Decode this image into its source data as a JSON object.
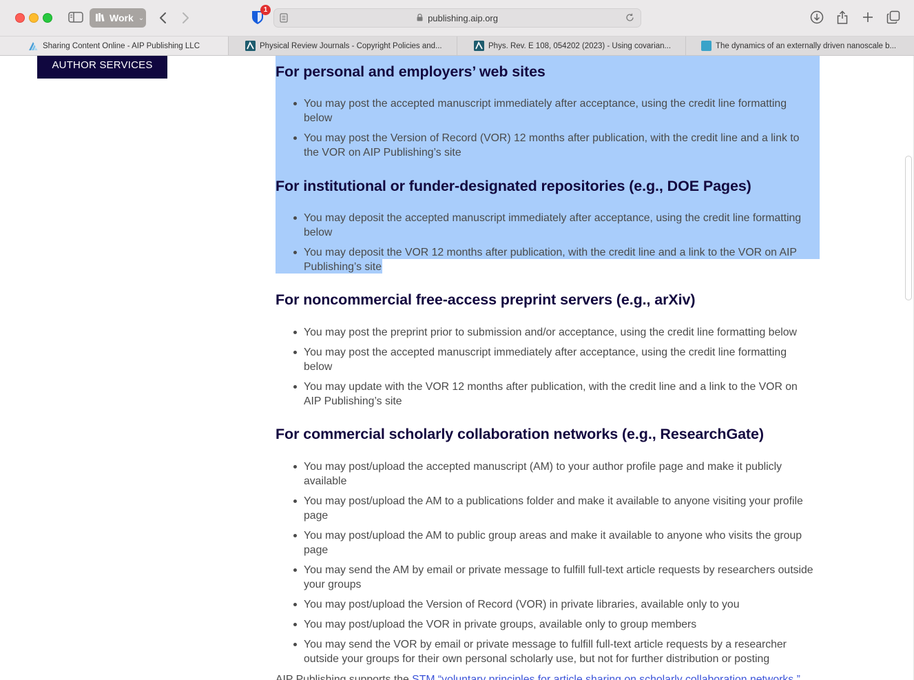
{
  "browser": {
    "profile": "Work",
    "extension_badge": "1",
    "address": "publishing.aip.org",
    "tabs": [
      {
        "title": "Sharing Content Online - AIP Publishing LLC",
        "active": true
      },
      {
        "title": "Physical Review Journals - Copyright Policies and...",
        "active": false
      },
      {
        "title": "Phys. Rev. E 108, 054202 (2023) - Using covarian...",
        "active": false
      },
      {
        "title": "The dynamics of an externally driven nanoscale b...",
        "active": false
      }
    ]
  },
  "sidebar": {
    "author_services": "AUTHOR SERVICES"
  },
  "sections": [
    {
      "heading": "For personal and employers’ web sites",
      "items": [
        "You may post the accepted manuscript immediately after acceptance, using the credit line formatting below",
        "You may post the Version of Record (VOR) 12 months after publication, with the credit line and a link to the VOR on AIP Publishing’s site"
      ]
    },
    {
      "heading": "For institutional or funder-designated repositories (e.g., DOE Pages)",
      "items": [
        "You may deposit the accepted manuscript immediately after acceptance, using the credit line formatting below",
        "You may deposit the VOR 12 months after publication, with the credit line and a link to the VOR on AIP Publishing’s site"
      ]
    },
    {
      "heading": "For noncommercial free-access preprint servers (e.g., arXiv)",
      "items": [
        "You may post the preprint prior to submission and/or acceptance, using the credit line formatting below",
        "You may post the accepted manuscript immediately after acceptance, using the credit line formatting below",
        "You may update with the VOR 12 months after publication, with the credit line and a link to the VOR on AIP Publishing’s site"
      ]
    },
    {
      "heading": "For commercial scholarly collaboration networks (e.g., ResearchGate)",
      "items": [
        "You may post/upload the accepted manuscript (AM) to your author profile page and make it publicly available",
        "You may post/upload the AM to a publications folder and make it available to anyone visiting your profile page",
        "You may post/upload the AM to public group areas and make it available to anyone who visits the group page",
        "You may send the AM by email or private message to fulfill full-text article requests by researchers outside your groups",
        "You may post/upload the Version of Record (VOR) in private libraries, available only to you",
        "You may post/upload the VOR in private groups, available only to group members",
        "You may send the VOR by email or private message to fulfill full-text article requests by a researcher outside your groups for their own personal scholarly use, but not for further distribution or posting"
      ]
    }
  ],
  "footer_partial": {
    "prefix": "AIP Publishing supports the ",
    "link": "STM “voluntary principles for article sharing on scholarly collaboration networks.”"
  },
  "colors": {
    "heading": "#13083f",
    "selection": "#a9cdfb",
    "author_button": "#10073f",
    "link": "#3b53d8"
  }
}
